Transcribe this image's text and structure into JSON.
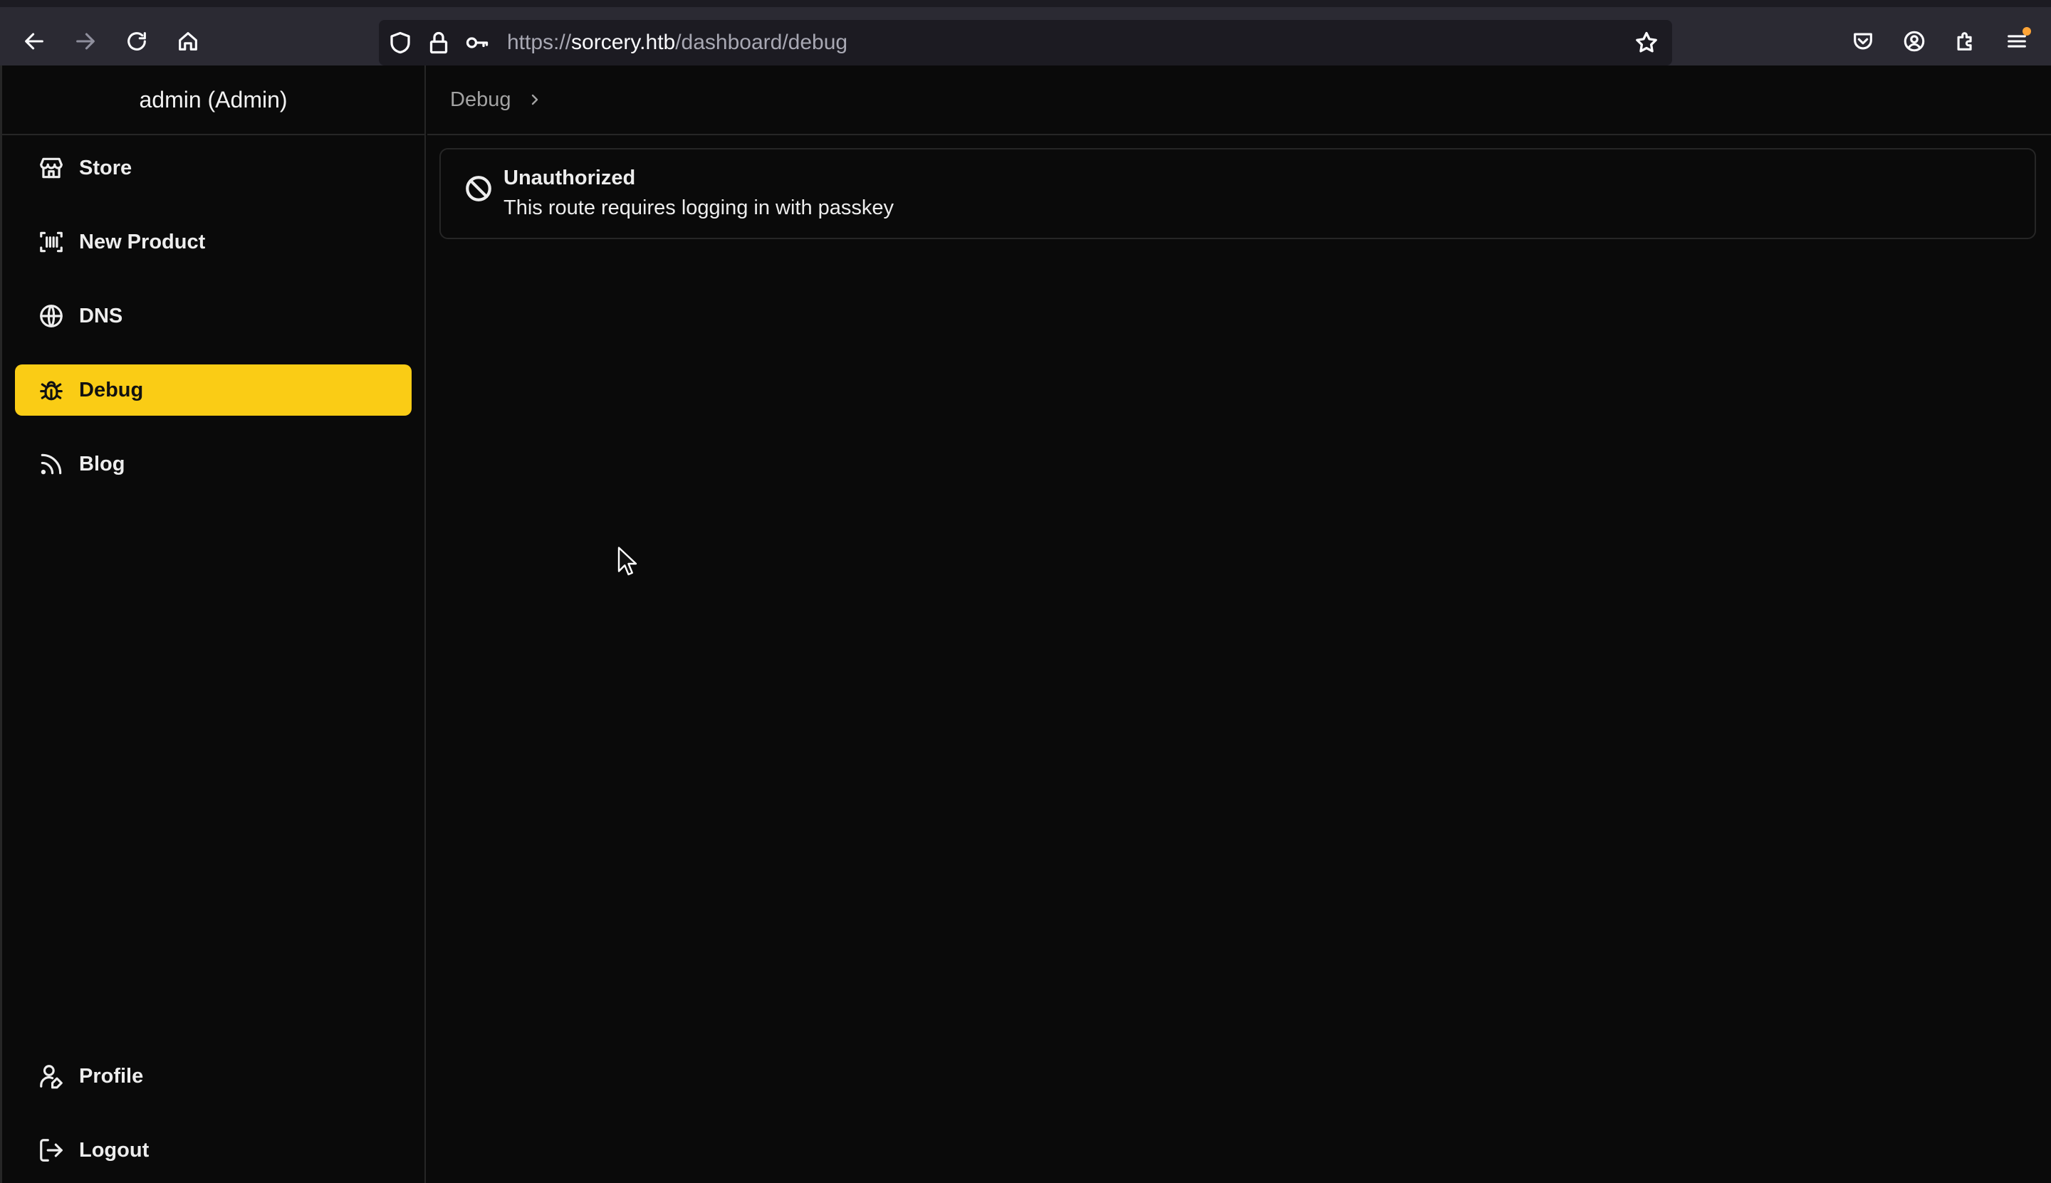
{
  "browser": {
    "url_scheme": "https://",
    "url_host": "sorcery.htb",
    "url_path": "/dashboard/debug"
  },
  "sidebar": {
    "user_label": "admin (Admin)",
    "items": [
      {
        "label": "Store",
        "icon": "store-icon"
      },
      {
        "label": "New Product",
        "icon": "scan-barcode-icon"
      },
      {
        "label": "DNS",
        "icon": "globe-icon"
      },
      {
        "label": "Debug",
        "icon": "bug-icon",
        "active": true
      },
      {
        "label": "Blog",
        "icon": "rss-icon"
      }
    ],
    "bottom_items": [
      {
        "label": "Profile",
        "icon": "user-pen-icon"
      },
      {
        "label": "Logout",
        "icon": "logout-icon"
      }
    ]
  },
  "main": {
    "breadcrumb": "Debug",
    "alert": {
      "title": "Unauthorized",
      "description": "This route requires logging in with passkey",
      "icon": "ban-icon"
    }
  },
  "colors": {
    "accent": "#facc15",
    "background": "#0a0a0a",
    "border": "#262626"
  }
}
